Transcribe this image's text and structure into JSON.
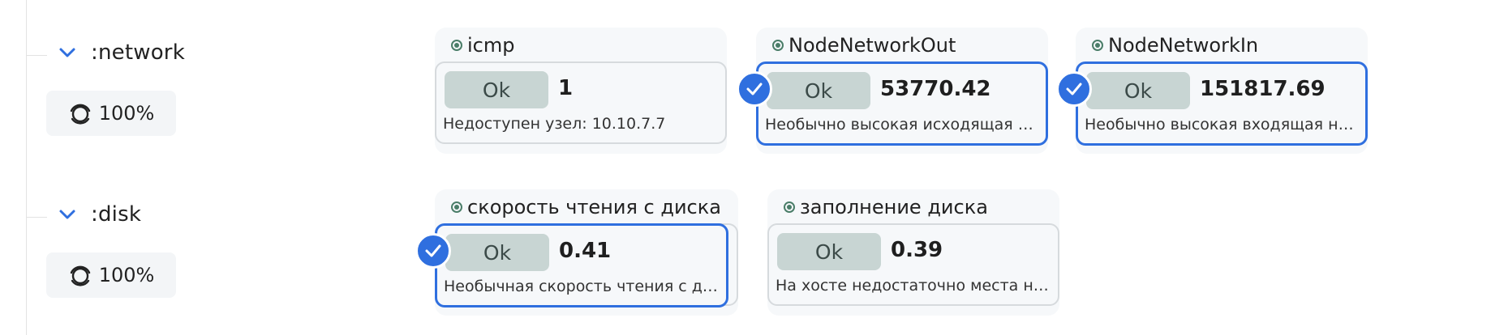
{
  "groups": [
    {
      "name": ":network",
      "percent": "100%",
      "cards": [
        {
          "title": "icmp",
          "status": "Ok",
          "value": "1",
          "description": "Недоступен узел: 10.10.7.7",
          "selected": false
        },
        {
          "title": "NodeNetworkOut",
          "status": "Ok",
          "value": "53770.42",
          "description": "Необычно высокая исходящая нагрузка на сеть",
          "selected": true
        },
        {
          "title": "NodeNetworkIn",
          "status": "Ok",
          "value": "151817.69",
          "description": "Необычно высокая входящая нагрузка на сеть",
          "selected": true
        }
      ]
    },
    {
      "name": ":disk",
      "percent": "100%",
      "cards": [
        {
          "title": "скорость чтения с диска",
          "status": "Ok",
          "value": "0.41",
          "description": "Необычная скорость чтения с диска",
          "selected": true
        },
        {
          "title": "заполнение диска",
          "status": "Ok",
          "value": "0.39",
          "description": "На хосте недостаточно места на диске",
          "selected": false
        }
      ]
    }
  ],
  "colors": {
    "accent": "#2f6fdf",
    "ok_button": "#c8d5d3",
    "status_dot": "#4a7d68",
    "card_bg": "#f6f8fa"
  },
  "icons": {
    "expand": "chevron-down-icon",
    "percent": "percent-gauge-icon",
    "status": "status-dot-icon",
    "selected": "check-circle-icon"
  }
}
